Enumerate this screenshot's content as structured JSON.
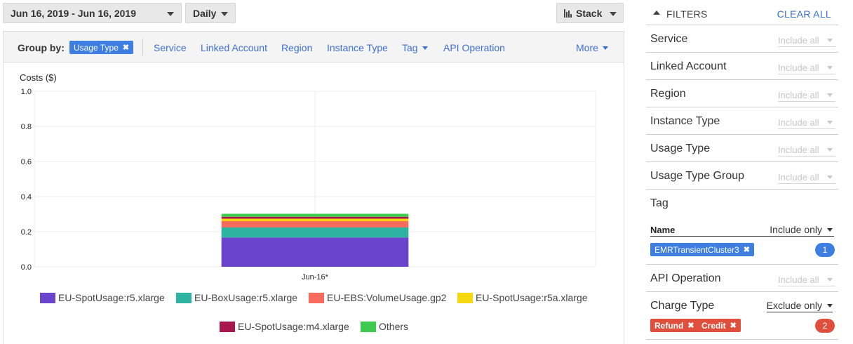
{
  "toolbar": {
    "date_range": "Jun 16, 2019 - Jun 16, 2019",
    "granularity": "Daily",
    "chart_style": "Stack"
  },
  "group_by": {
    "label": "Group by:",
    "active_chip": "Usage Type",
    "options": [
      "Service",
      "Linked Account",
      "Region",
      "Instance Type",
      "Tag",
      "API Operation"
    ],
    "more": "More"
  },
  "chart_data": {
    "type": "bar",
    "stacked": true,
    "ylabel": "Costs ($)",
    "ylim": [
      0,
      1.0
    ],
    "yticks": [
      "1.0",
      "0.8",
      "0.6",
      "0.4",
      "0.2",
      "0.0"
    ],
    "categories": [
      "Jun-16*"
    ],
    "grid": true,
    "legend_position": "bottom",
    "series": [
      {
        "name": "EU-SpotUsage:r5.xlarge",
        "color": "#6a44cc",
        "values": [
          0.167
        ]
      },
      {
        "name": "EU-BoxUsage:r5.xlarge",
        "color": "#2db3a0",
        "values": [
          0.057
        ]
      },
      {
        "name": "EU-EBS:VolumeUsage.gp2",
        "color": "#f56c5e",
        "values": [
          0.036
        ]
      },
      {
        "name": "EU-SpotUsage:r5a.xlarge",
        "color": "#f5d80f",
        "values": [
          0.014
        ]
      },
      {
        "name": "EU-SpotUsage:m4.xlarge",
        "color": "#a8184e",
        "values": [
          0.011
        ]
      },
      {
        "name": "Others",
        "color": "#3ec94f",
        "values": [
          0.017
        ]
      }
    ]
  },
  "filters": {
    "title": "FILTERS",
    "clear_all": "CLEAR ALL",
    "include_all": "Include all",
    "rows": [
      "Service",
      "Linked Account",
      "Region",
      "Instance Type",
      "Usage Type",
      "Usage Type Group"
    ],
    "tag": {
      "label": "Tag",
      "name_label": "Name",
      "mode": "Include only",
      "chips": [
        "EMRTransientCluster3"
      ],
      "count": "1",
      "count_color": "#3d7ee0"
    },
    "api_operation": {
      "label": "API Operation"
    },
    "charge_type": {
      "label": "Charge Type",
      "mode": "Exclude only",
      "chips": [
        "Refund",
        "Credit"
      ],
      "count": "2",
      "count_color": "#e04f3c"
    }
  }
}
